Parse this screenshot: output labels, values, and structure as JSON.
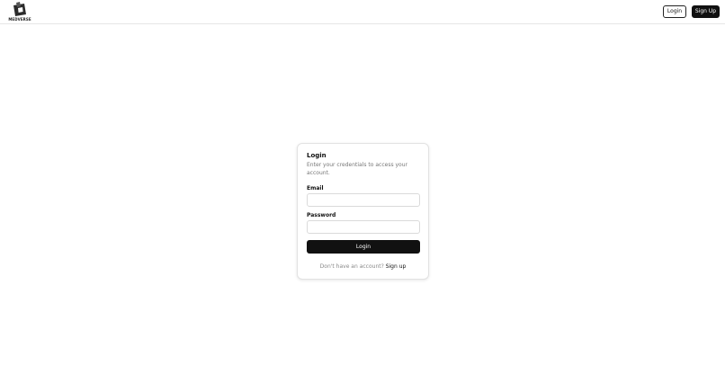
{
  "header": {
    "logo_text": "MEDVERSE",
    "login_label": "Login",
    "signup_label": "Sign Up"
  },
  "form": {
    "title": "Login",
    "description": "Enter your credentials to access your account.",
    "email_label": "Email",
    "email_value": "",
    "password_label": "Password",
    "password_value": "",
    "submit_label": "Login",
    "no_account_text": "Don't have an account?",
    "signup_link": "Sign up"
  },
  "colors": {
    "primary": "#111111",
    "border": "#e2e2e2",
    "muted_text": "#777777"
  }
}
